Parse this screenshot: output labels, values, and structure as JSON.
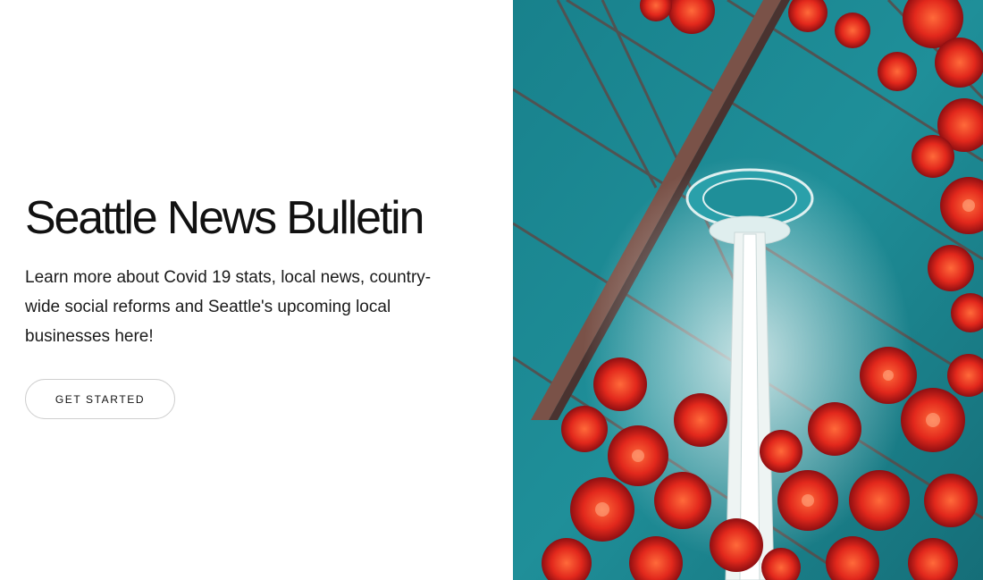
{
  "hero": {
    "title": "Seattle News Bulletin",
    "description": "Learn more about Covid 19 stats, local news, country-wide social reforms and Seattle's upcoming local businesses here!",
    "cta_label": "GET STARTED"
  },
  "photo": {
    "subject": "Space Needle viewed through glass ceiling with red glass flowers",
    "colors": {
      "sky": "#1f8a94",
      "flowers": "#e0291f",
      "beams": "#6e4a44"
    }
  }
}
